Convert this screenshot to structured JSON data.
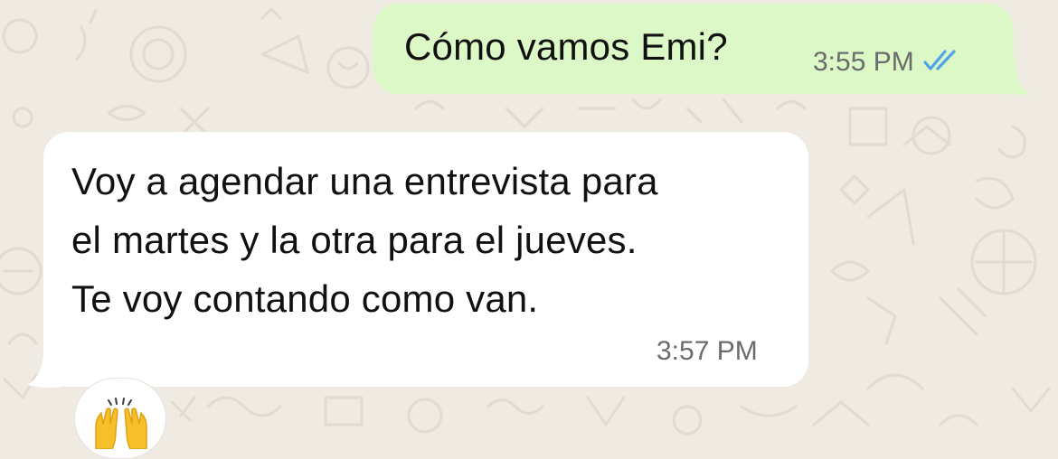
{
  "colors": {
    "wallpaper": "#efeae2",
    "outgoing_bubble": "#dcf8c6",
    "incoming_bubble": "#ffffff",
    "read_ticks": "#4fa3e8",
    "timestamp": "#6b6b6b"
  },
  "messages": {
    "outgoing": {
      "text": "Cómo vamos Emi?",
      "time": "3:55 PM",
      "status_icon": "double-check-read-icon"
    },
    "incoming": {
      "lines": [
        "Voy a agendar una entrevista para",
        "el martes y la otra para el jueves.",
        "Te voy contando como van."
      ],
      "time": "3:57 PM",
      "reaction_icon": "raising-hands-emoji-icon"
    }
  }
}
